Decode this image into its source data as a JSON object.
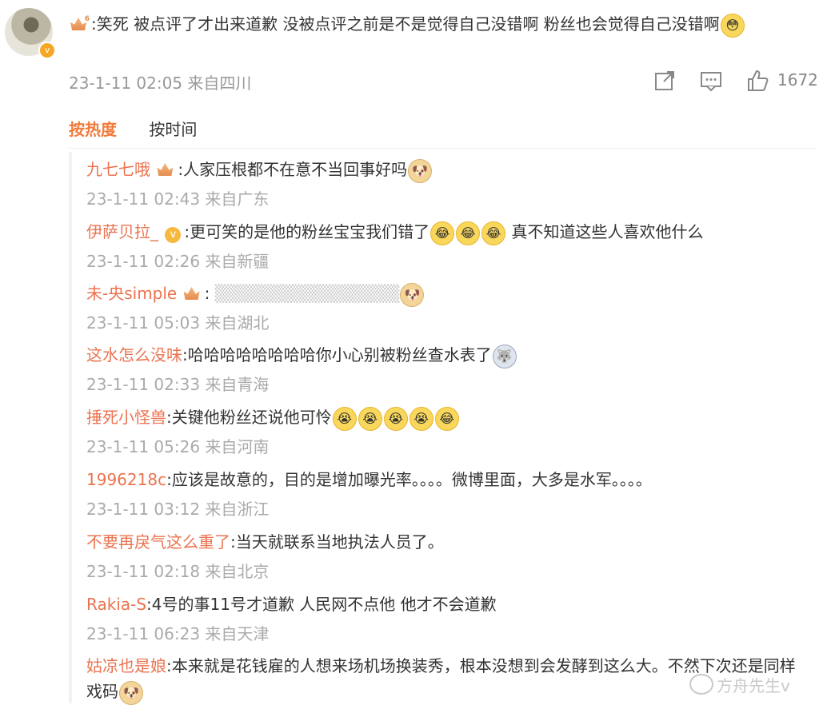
{
  "main": {
    "badge_level": "6",
    "text": ":笑死 被点评了才出来道歉 没被点评之前是不是觉得自己没错啊 粉丝也会觉得自己没错啊",
    "date": "23-1-11 02:05 来自四川",
    "like_count": "1672"
  },
  "tabs": {
    "hot": "按热度",
    "time": "按时间"
  },
  "replies": [
    {
      "name": "九七七哦",
      "text": ":人家压根都不在意不当回事好吗",
      "time": "23-1-11 02:43 来自广东"
    },
    {
      "name": "伊萨贝拉_",
      "text": ":更可笑的是他的粉丝宝宝我们错了",
      "text2": " 真不知道这些人喜欢他什么",
      "time": "23-1-11 02:26 来自新疆"
    },
    {
      "name": "未-央simple",
      "text": ": ",
      "time": "23-1-11 05:03 来自湖北"
    },
    {
      "name": "这水怎么没味",
      "text": ":哈哈哈哈哈哈哈哈你小心别被粉丝查水表了",
      "time": "23-1-11 02:33 来自青海"
    },
    {
      "name": "捶死小怪兽",
      "text": ":关键他粉丝还说他可怜",
      "time": "23-1-11 05:26 来自河南"
    },
    {
      "name": "1996218c",
      "text": ":应该是故意的，目的是增加曝光率。。。。微博里面，大多是水军。。。。",
      "time": "23-1-11 03:12 来自浙江"
    },
    {
      "name": "不要再戾气这么重了",
      "text": ":当天就联系当地执法人员了。",
      "time": "23-1-11 02:18 来自北京"
    },
    {
      "name": "Rakia-S",
      "text": ":4号的事11号才道歉 人民网不点他 他才不会道歉",
      "time": "23-1-11 06:23 来自天津"
    },
    {
      "name": "姑凉也是娘",
      "text": ":本来就是花钱雇的人想来场机场换装秀，根本没想到会发酵到这么大。不然下次还是同样戏码"
    }
  ],
  "watermark": "方舟先生v",
  "icons": [
    "share-icon",
    "comment-icon",
    "like-icon",
    "crown-badge-icon",
    "verified-badge-icon",
    "emoji-icon"
  ]
}
